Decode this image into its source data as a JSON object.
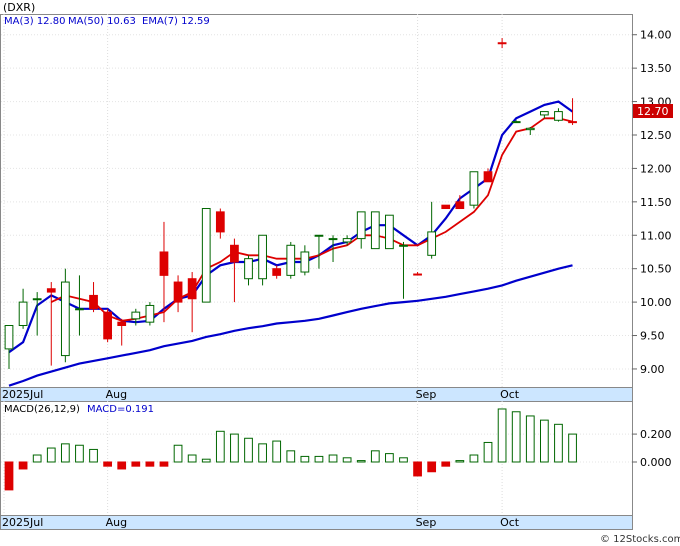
{
  "chart_data": {
    "type": "candlestick",
    "ticker_label": "(DXR)",
    "legend": [
      {
        "label": "MA(3)",
        "value": "12.80",
        "color": "#0000cc"
      },
      {
        "label": "MA(50)",
        "value": "10.63",
        "color": "#0000cc"
      },
      {
        "label": "EMA(7)",
        "value": "12.59",
        "color": "#0000cc"
      }
    ],
    "last_price_label": "12.70",
    "price_axis": {
      "min": 8.73,
      "max": 14.31,
      "ticks": [
        "14.00",
        "13.50",
        "13.00",
        "12.50",
        "12.00",
        "11.50",
        "11.00",
        "10.50",
        "10.00",
        "9.50",
        "9.00"
      ]
    },
    "x_labels": [
      {
        "label": "2025Jul",
        "index": 0
      },
      {
        "label": "Aug",
        "index": 7
      },
      {
        "label": "Sep",
        "index": 29
      },
      {
        "label": "Oct",
        "index": 35
      }
    ],
    "candles": [
      {
        "o": 9.3,
        "h": 9.65,
        "l": 9.0,
        "c": 9.65,
        "up": true
      },
      {
        "o": 9.65,
        "h": 10.2,
        "l": 9.6,
        "c": 10.0,
        "up": true
      },
      {
        "o": 10.05,
        "h": 10.15,
        "l": 9.5,
        "c": 10.05,
        "up": true
      },
      {
        "o": 10.2,
        "h": 10.3,
        "l": 9.05,
        "c": 10.15,
        "up": false
      },
      {
        "o": 9.2,
        "h": 10.5,
        "l": 9.1,
        "c": 10.3,
        "up": true
      },
      {
        "o": 9.9,
        "h": 10.4,
        "l": 9.5,
        "c": 9.9,
        "up": true
      },
      {
        "o": 10.1,
        "h": 10.3,
        "l": 9.85,
        "c": 9.9,
        "up": false
      },
      {
        "o": 9.85,
        "h": 9.9,
        "l": 9.4,
        "c": 9.45,
        "up": false
      },
      {
        "o": 9.7,
        "h": 9.75,
        "l": 9.35,
        "c": 9.65,
        "up": false
      },
      {
        "o": 9.75,
        "h": 9.9,
        "l": 9.65,
        "c": 9.85,
        "up": true
      },
      {
        "o": 9.7,
        "h": 10.0,
        "l": 9.65,
        "c": 9.95,
        "up": true
      },
      {
        "o": 10.75,
        "h": 11.2,
        "l": 9.7,
        "c": 10.4,
        "up": false
      },
      {
        "o": 10.3,
        "h": 10.4,
        "l": 9.85,
        "c": 10.0,
        "up": false
      },
      {
        "o": 10.35,
        "h": 10.45,
        "l": 9.55,
        "c": 10.05,
        "up": false
      },
      {
        "o": 10.0,
        "h": 11.4,
        "l": 10.0,
        "c": 11.4,
        "up": true
      },
      {
        "o": 11.35,
        "h": 11.4,
        "l": 10.95,
        "c": 11.05,
        "up": false
      },
      {
        "o": 10.85,
        "h": 10.95,
        "l": 10.0,
        "c": 10.6,
        "up": false
      },
      {
        "o": 10.35,
        "h": 10.7,
        "l": 10.25,
        "c": 10.65,
        "up": true
      },
      {
        "o": 10.35,
        "h": 11.0,
        "l": 10.25,
        "c": 11.0,
        "up": true
      },
      {
        "o": 10.5,
        "h": 10.55,
        "l": 10.35,
        "c": 10.4,
        "up": false
      },
      {
        "o": 10.4,
        "h": 10.9,
        "l": 10.35,
        "c": 10.85,
        "up": true
      },
      {
        "o": 10.45,
        "h": 10.85,
        "l": 10.4,
        "c": 10.75,
        "up": true
      },
      {
        "o": 11.0,
        "h": 11.0,
        "l": 10.5,
        "c": 11.0,
        "up": true
      },
      {
        "o": 10.95,
        "h": 11.0,
        "l": 10.6,
        "c": 10.95,
        "up": true
      },
      {
        "o": 10.9,
        "h": 11.0,
        "l": 10.85,
        "c": 10.95,
        "up": true
      },
      {
        "o": 10.95,
        "h": 11.35,
        "l": 10.8,
        "c": 11.35,
        "up": true
      },
      {
        "o": 11.35,
        "h": 11.35,
        "l": 10.8,
        "c": 10.8,
        "up": true
      },
      {
        "o": 10.8,
        "h": 11.3,
        "l": 10.8,
        "c": 11.3,
        "up": true
      },
      {
        "o": 10.85,
        "h": 10.9,
        "l": 10.05,
        "c": 10.85,
        "up": true
      },
      {
        "o": 10.42,
        "h": 10.45,
        "l": 10.4,
        "c": 10.42,
        "up": false
      },
      {
        "o": 10.7,
        "h": 11.5,
        "l": 10.65,
        "c": 11.05,
        "up": true
      },
      {
        "o": 11.45,
        "h": 11.45,
        "l": 11.4,
        "c": 11.4,
        "up": false
      },
      {
        "o": 11.5,
        "h": 11.6,
        "l": 11.4,
        "c": 11.4,
        "up": false
      },
      {
        "o": 11.45,
        "h": 11.95,
        "l": 11.4,
        "c": 11.95,
        "up": true
      },
      {
        "o": 11.95,
        "h": 12.0,
        "l": 11.8,
        "c": 11.8,
        "up": false
      },
      {
        "o": 13.88,
        "h": 13.95,
        "l": 13.8,
        "c": 13.88,
        "up": false
      },
      {
        "o": 12.7,
        "h": 12.72,
        "l": 12.68,
        "c": 12.7,
        "up": true
      },
      {
        "o": 12.6,
        "h": 12.62,
        "l": 12.5,
        "c": 12.58,
        "up": true
      },
      {
        "o": 12.8,
        "h": 12.85,
        "l": 12.75,
        "c": 12.85,
        "up": true
      },
      {
        "o": 12.72,
        "h": 12.9,
        "l": 12.7,
        "c": 12.85,
        "up": true
      },
      {
        "o": 12.7,
        "h": 13.05,
        "l": 12.65,
        "c": 12.7,
        "up": false
      }
    ],
    "ema7": [
      null,
      null,
      null,
      10.0,
      10.1,
      10.05,
      10.0,
      9.8,
      9.72,
      9.75,
      9.8,
      9.85,
      10.05,
      10.15,
      10.5,
      10.6,
      10.75,
      10.7,
      10.7,
      10.65,
      10.65,
      10.65,
      10.7,
      10.8,
      10.85,
      11.0,
      11.0,
      10.95,
      10.85,
      10.85,
      10.95,
      11.05,
      11.2,
      11.35,
      11.6,
      12.2,
      12.55,
      12.6,
      12.75,
      12.75,
      12.7
    ],
    "ma3": [
      9.25,
      9.4,
      9.95,
      10.1,
      10.0,
      9.9,
      9.9,
      9.9,
      9.72,
      9.7,
      9.72,
      9.9,
      10.05,
      10.1,
      10.4,
      10.55,
      10.6,
      10.6,
      10.65,
      10.55,
      10.6,
      10.6,
      10.7,
      10.85,
      10.9,
      11.05,
      11.15,
      11.15,
      11.0,
      10.85,
      11.0,
      11.25,
      11.55,
      11.7,
      11.85,
      12.5,
      12.75,
      12.85,
      12.95,
      13.0,
      12.85
    ],
    "ma50": [
      8.75,
      8.82,
      8.9,
      8.96,
      9.02,
      9.08,
      9.12,
      9.16,
      9.2,
      9.24,
      9.28,
      9.34,
      9.38,
      9.42,
      9.48,
      9.52,
      9.57,
      9.61,
      9.64,
      9.68,
      9.7,
      9.72,
      9.75,
      9.8,
      9.85,
      9.9,
      9.94,
      9.98,
      10.0,
      10.02,
      10.05,
      10.08,
      10.12,
      10.16,
      10.2,
      10.25,
      10.32,
      10.38,
      10.44,
      10.5,
      10.55
    ],
    "macd_label": "MACD(26,12,9)",
    "macd_value_label": "MACD=0.191",
    "macd_axis": {
      "min": -0.38,
      "max": 0.43,
      "ticks": [
        "0.200",
        "0.000"
      ]
    },
    "macd_hist": [
      -0.2,
      -0.05,
      0.05,
      0.1,
      0.13,
      0.12,
      0.09,
      -0.03,
      -0.05,
      -0.03,
      -0.03,
      -0.03,
      0.12,
      0.05,
      0.02,
      0.22,
      0.2,
      0.17,
      0.13,
      0.15,
      0.08,
      0.04,
      0.04,
      0.05,
      0.03,
      0.01,
      0.08,
      0.06,
      0.03,
      -0.1,
      -0.07,
      -0.03,
      0.01,
      0.05,
      0.14,
      0.38,
      0.36,
      0.33,
      0.3,
      0.27,
      0.2
    ]
  },
  "footer": {
    "copyright": "© 12Stocks.com"
  },
  "colors": {
    "up": "#ffffff",
    "up_border": "#006600",
    "down": "#dd0000",
    "ma": "#0000cc",
    "ema": "#dd0000",
    "hist_up": "#ffffff",
    "hist_down": "#dd0000",
    "axis_bar": "#cce6ff",
    "price_tag": "#cc0000"
  }
}
